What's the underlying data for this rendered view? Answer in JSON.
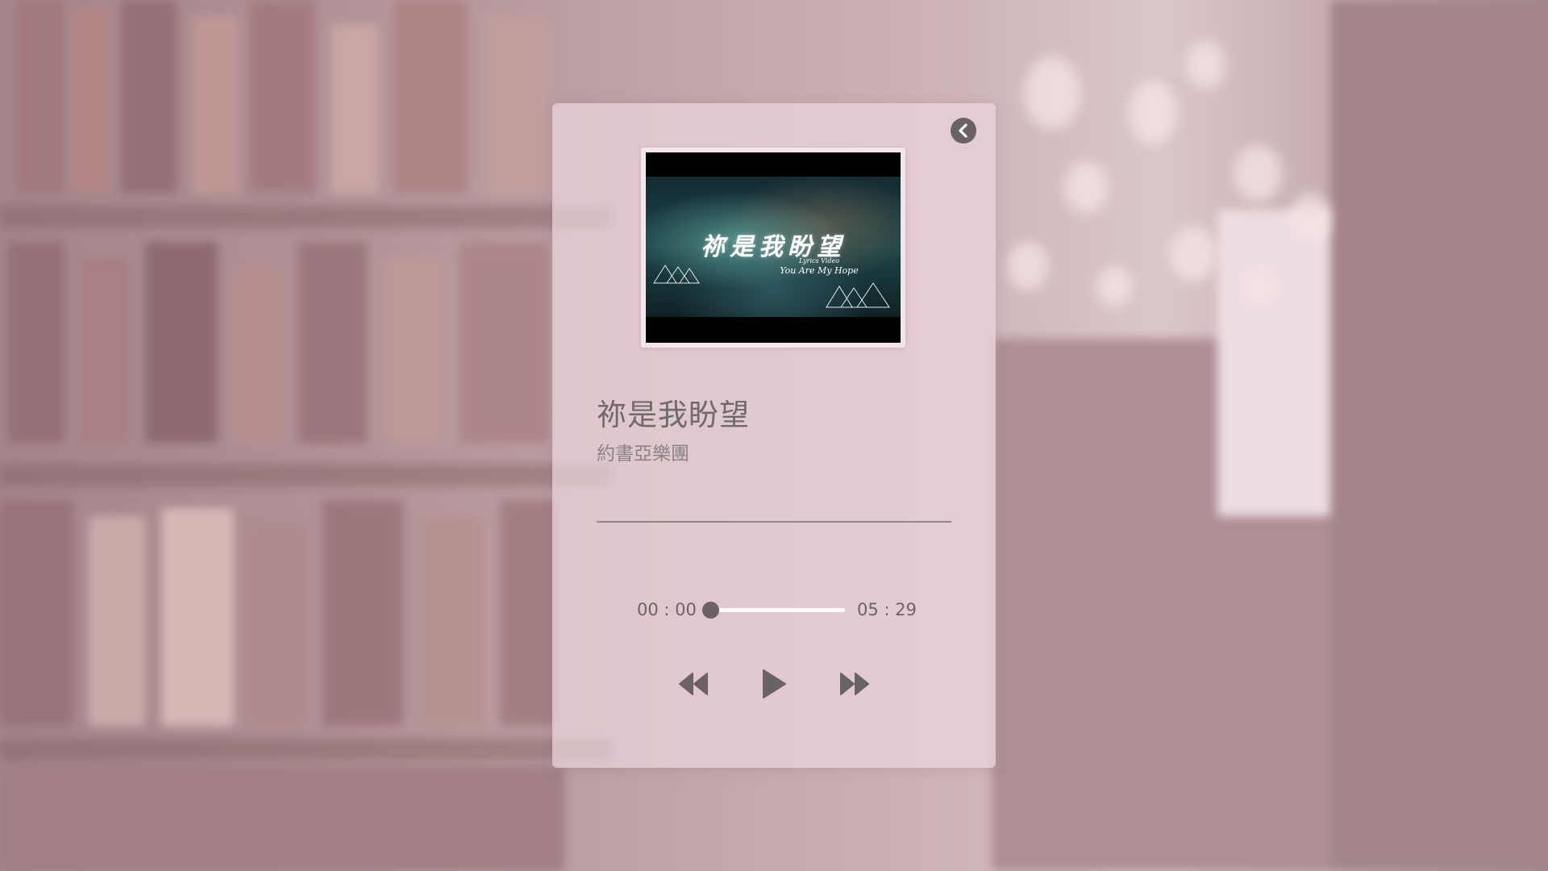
{
  "player": {
    "song_title": "祢是我盼望",
    "artist": "約書亞樂團",
    "cover": {
      "title": "祢是我盼望",
      "subtitle_small": "Lyrics Video",
      "subtitle_en": "You Are My Hope"
    },
    "time_current": "00 : 00",
    "time_total": "05 : 29",
    "progress": 0
  },
  "colors": {
    "icon": "#6a6264",
    "track": "#ffffff",
    "title_text": "#6f6a6b",
    "artist_text": "#8a8385"
  },
  "icons": {
    "back": "chevron-left-icon",
    "prev": "rewind-icon",
    "play": "play-icon",
    "next": "fast-forward-icon"
  }
}
